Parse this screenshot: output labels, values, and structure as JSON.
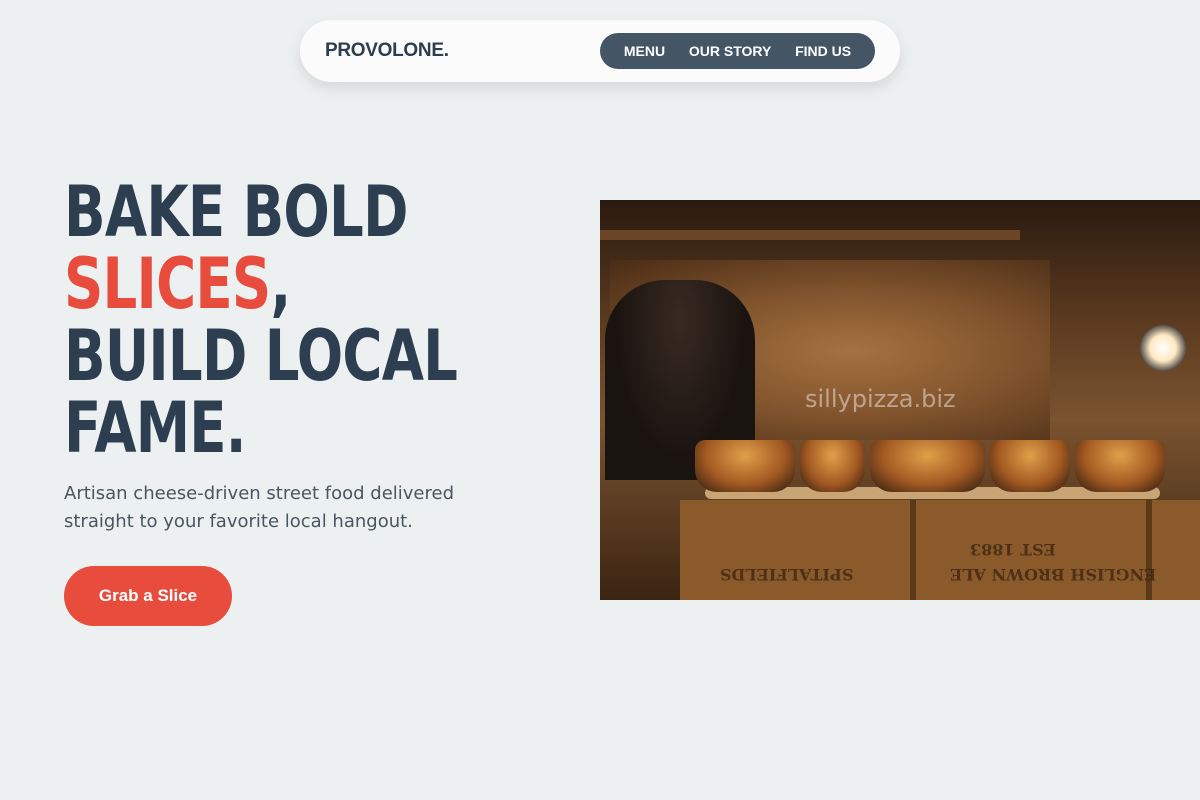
{
  "nav": {
    "logo": "PROVOLONE.",
    "links": [
      "MENU",
      "OUR STORY",
      "FIND US"
    ]
  },
  "hero": {
    "title_line1": "BAKE BOLD",
    "title_accent": "SLICES",
    "title_comma": ",",
    "title_line3": "BUILD LOCAL",
    "title_line4": "FAME.",
    "subtitle": "Artisan cheese-driven street food delivered straight to your favorite local hangout.",
    "cta_label": "Grab a Slice"
  },
  "photo": {
    "watermark": "sillypizza.biz",
    "crate_text_1": "SPITALFIELDS",
    "crate_text_2": "EST 1883",
    "crate_text_3": "ENGLISH BROWN ALE"
  },
  "colors": {
    "background": "#ecf0f1",
    "primary": "#2c3e50",
    "accent": "#e74c3c",
    "nav_pill": "#445566"
  }
}
